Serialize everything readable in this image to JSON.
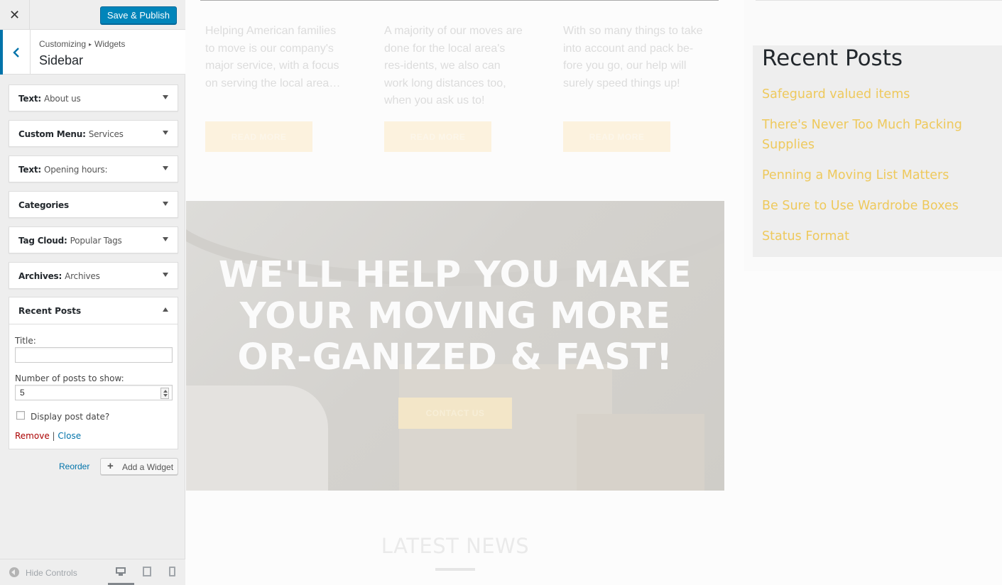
{
  "customizer": {
    "close_glyph": "✕",
    "save_label": "Save & Publish",
    "breadcrumb": {
      "root": "Customizing",
      "separator": "▸",
      "current": "Widgets"
    },
    "section_title": "Sidebar",
    "widgets": [
      {
        "type": "Text",
        "name": "About us"
      },
      {
        "type": "Custom Menu",
        "name": "Services"
      },
      {
        "type": "Text",
        "name": "Opening hours:"
      },
      {
        "type": "Categories",
        "name": ""
      },
      {
        "type": "Tag Cloud",
        "name": "Popular Tags"
      },
      {
        "type": "Archives",
        "name": "Archives"
      }
    ],
    "open_widget": {
      "type": "Recent Posts",
      "title_label": "Title:",
      "title_value": "",
      "count_label": "Number of posts to show:",
      "count_value": "5",
      "show_date_label": "Display post date?",
      "show_date_checked": false,
      "remove_label": "Remove",
      "divider": "|",
      "close_label": "Close"
    },
    "reorder_label": "Reorder",
    "add_widget_label": "Add a Widget",
    "footer": {
      "hide_controls_label": "Hide Controls"
    },
    "colors": {
      "primary": "#0085ba",
      "link": "#0073aa",
      "remove": "#aa0000"
    }
  },
  "preview": {
    "services": [
      {
        "text": "Helping American families to move is our company's major service, with a focus on serving the local area…",
        "button": "READ MORE"
      },
      {
        "text": "A majority of our moves are done for the local area's res-idents, we also can work long distances too, when you ask us to!",
        "button": "READ MORE"
      },
      {
        "text": "With so many things to take into account and pack be-fore you go, our help will surely speed things up!",
        "button": "READ MORE"
      }
    ],
    "hero": {
      "headline": "WE'LL HELP YOU MAKE YOUR MOVING MORE OR-GANIZED & FAST!",
      "button": "CONTACT US"
    },
    "latest_news": "LATEST NEWS",
    "recent_posts": {
      "title": "Recent Posts",
      "items": [
        "Safeguard valued items",
        "There's Never Too Much Packing Supplies",
        "Penning a Moving List Matters",
        "Be Sure to Use Wardrobe Boxes",
        "Status Format"
      ],
      "link_color": "#eec95c"
    }
  }
}
